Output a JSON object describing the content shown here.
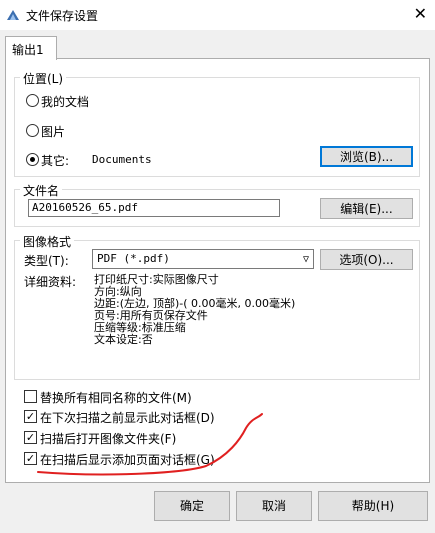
{
  "window": {
    "title": "文件保存设置"
  },
  "tabs": [
    {
      "label": "输出1"
    }
  ],
  "location": {
    "group_label": "位置(L)",
    "options": [
      {
        "label": "我的文档",
        "checked": false
      },
      {
        "label": "图片",
        "checked": false
      },
      {
        "label": "其它:",
        "checked": true
      }
    ],
    "other_path": "Documents",
    "browse_label": "浏览(B)..."
  },
  "filename": {
    "group_label": "文件名",
    "value": "A20160526_65.pdf",
    "edit_label": "编辑(E)..."
  },
  "image_format": {
    "group_label": "图像格式",
    "type_label": "类型(T):",
    "type_value": "PDF (*.pdf)",
    "options_label": "选项(O)...",
    "details_label": "详细资料:",
    "details": [
      "打印纸尺寸:实际图像尺寸",
      "方向:纵向",
      "边距:(左边, 顶部)-( 0.00毫米, 0.00毫米)",
      "页号:用所有页保存文件",
      "压缩等级:标准压缩",
      "文本设定:否"
    ]
  },
  "checkboxes": [
    {
      "label": "替换所有相同名称的文件(M)",
      "checked": false
    },
    {
      "label": "在下次扫描之前显示此对话框(D)",
      "checked": true
    },
    {
      "label": "扫描后打开图像文件夹(F)",
      "checked": true
    },
    {
      "label": "在扫描后显示添加页面对话框(G)",
      "checked": true
    }
  ],
  "footer": {
    "ok_label": "确定",
    "cancel_label": "取消",
    "help_label": "帮助(H)"
  },
  "colors": {
    "annotation_red": "#e02020",
    "focus_blue": "#0078d7"
  }
}
